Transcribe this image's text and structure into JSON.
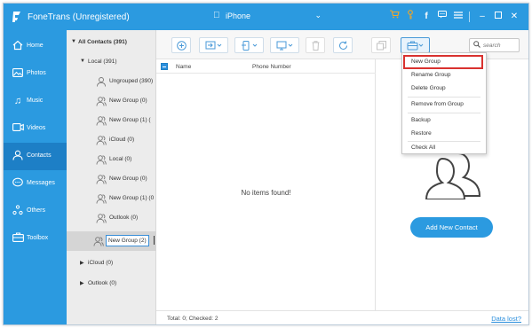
{
  "app": {
    "title": "FoneTrans (Unregistered)"
  },
  "device": {
    "name": "iPhone"
  },
  "titlebar_icons": [
    "cart-icon",
    "key-icon",
    "facebook-icon",
    "chat-icon",
    "menu-icon",
    "minimize-icon",
    "maximize-icon",
    "close-icon"
  ],
  "nav": [
    {
      "label": "Home",
      "icon": "home-icon"
    },
    {
      "label": "Photos",
      "icon": "photos-icon"
    },
    {
      "label": "Music",
      "icon": "music-icon"
    },
    {
      "label": "Videos",
      "icon": "videos-icon"
    },
    {
      "label": "Contacts",
      "icon": "contacts-icon"
    },
    {
      "label": "Messages",
      "icon": "messages-icon"
    },
    {
      "label": "Others",
      "icon": "others-icon"
    },
    {
      "label": "Toolbox",
      "icon": "toolbox-icon"
    }
  ],
  "active_nav": "Contacts",
  "tree": {
    "all": "All Contacts  (391)",
    "local": "Local  (391)",
    "groups": [
      "Ungrouped  (390)",
      "New Group  (0)",
      "New Group (1)  (",
      "iCloud  (0)",
      "Local  (0)",
      "New Group  (0)",
      "New Group (1)  (0",
      "Outlook  (0)"
    ],
    "editing_value": "New Group (2)",
    "icloud": "iCloud  (0)",
    "outlook": "Outlook  (0)"
  },
  "search": {
    "placeholder": "search"
  },
  "list": {
    "col_name": "Name",
    "col_phone": "Phone Number",
    "empty": "No items found!"
  },
  "detail": {
    "add_button": "Add New Contact"
  },
  "status": {
    "total": "Total: 0; Checked: 2",
    "data_lost": "Data lost?"
  },
  "menu": {
    "items": [
      "New Group",
      "Rename Group",
      "Delete Group",
      "Remove from Group",
      "Backup",
      "Restore",
      "Check All"
    ]
  },
  "colors": {
    "accent": "#2b9ae0",
    "active_nav": "#1d7fc6",
    "highlight": "#d9322f"
  }
}
